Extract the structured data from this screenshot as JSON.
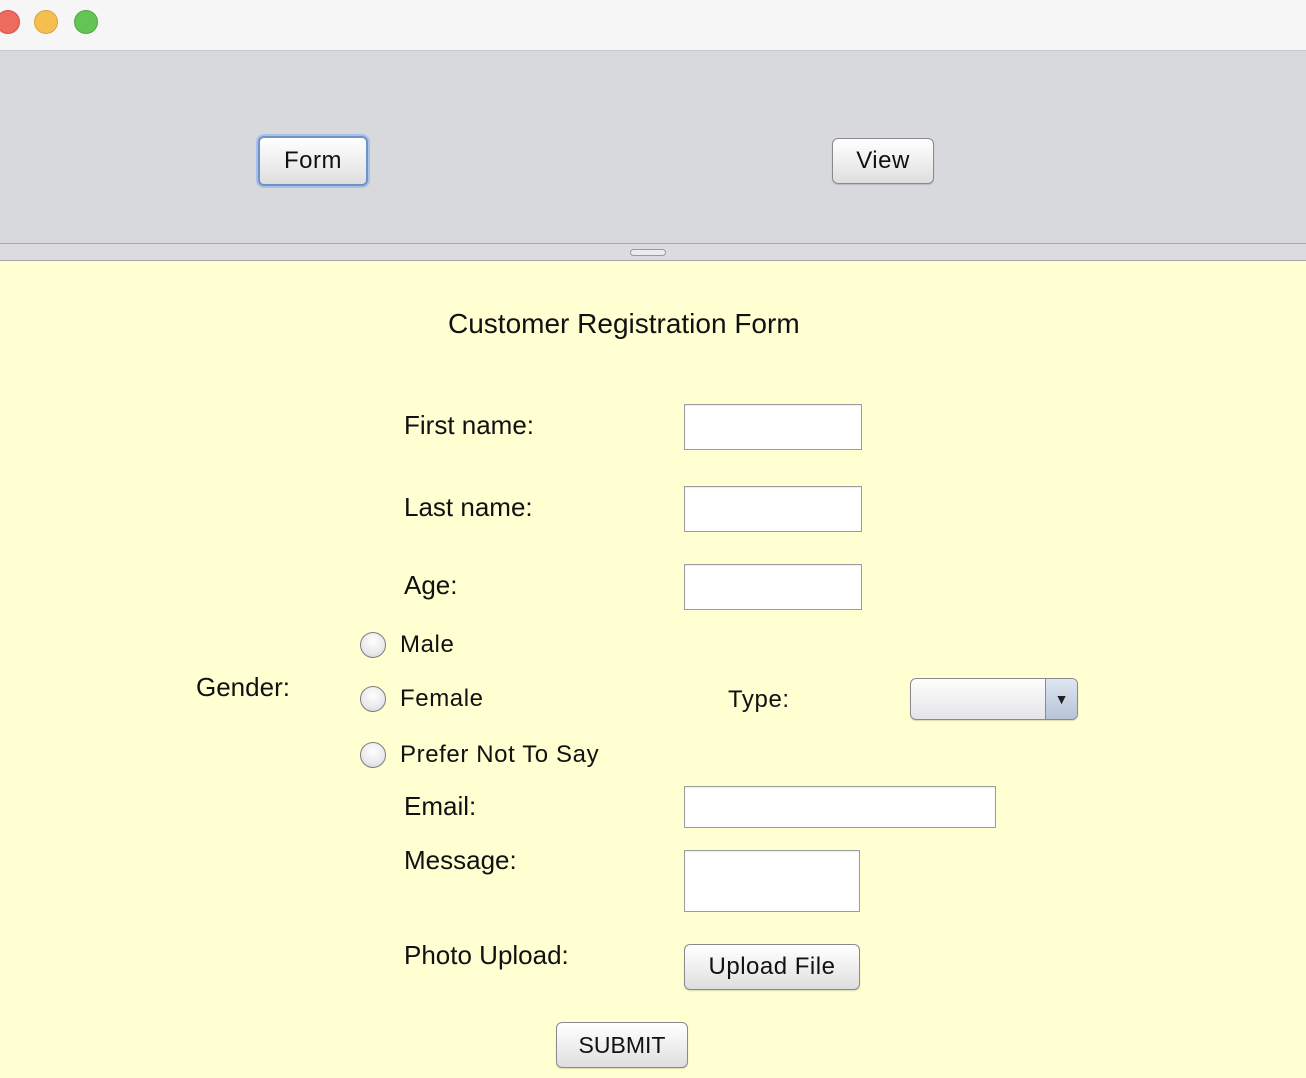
{
  "toolbar": {
    "form_button": "Form",
    "view_button": "View"
  },
  "form": {
    "title": "Customer Registration Form",
    "first_name_label": "First name:",
    "last_name_label": "Last name:",
    "age_label": "Age:",
    "gender_label": "Gender:",
    "gender_options": [
      "Male",
      "Female",
      "Prefer Not To Say"
    ],
    "type_label": "Type:",
    "type_selected": "",
    "email_label": "Email:",
    "message_label": "Message:",
    "photo_label": "Photo Upload:",
    "upload_button": "Upload File",
    "submit_button": "SUBMIT"
  },
  "icons": {
    "combo_arrow": "chevron-down-icon"
  }
}
